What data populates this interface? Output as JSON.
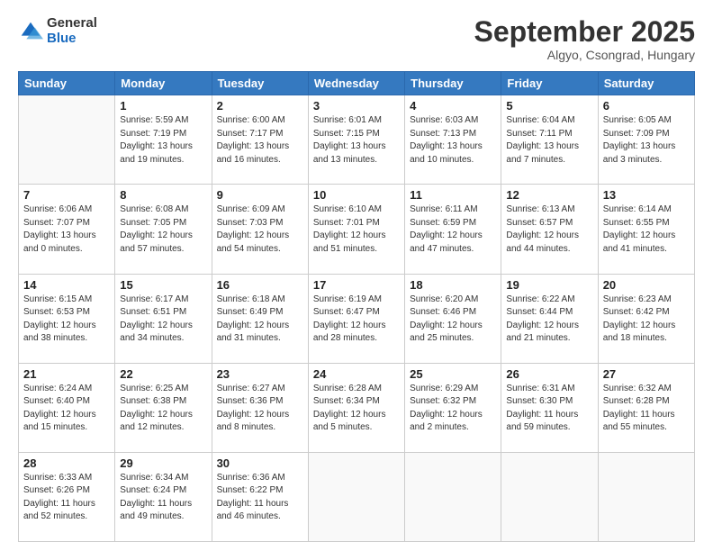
{
  "logo": {
    "general": "General",
    "blue": "Blue"
  },
  "header": {
    "month": "September 2025",
    "location": "Algyo, Csongrad, Hungary"
  },
  "days_of_week": [
    "Sunday",
    "Monday",
    "Tuesday",
    "Wednesday",
    "Thursday",
    "Friday",
    "Saturday"
  ],
  "weeks": [
    [
      {
        "day": "",
        "info": ""
      },
      {
        "day": "1",
        "info": "Sunrise: 5:59 AM\nSunset: 7:19 PM\nDaylight: 13 hours\nand 19 minutes."
      },
      {
        "day": "2",
        "info": "Sunrise: 6:00 AM\nSunset: 7:17 PM\nDaylight: 13 hours\nand 16 minutes."
      },
      {
        "day": "3",
        "info": "Sunrise: 6:01 AM\nSunset: 7:15 PM\nDaylight: 13 hours\nand 13 minutes."
      },
      {
        "day": "4",
        "info": "Sunrise: 6:03 AM\nSunset: 7:13 PM\nDaylight: 13 hours\nand 10 minutes."
      },
      {
        "day": "5",
        "info": "Sunrise: 6:04 AM\nSunset: 7:11 PM\nDaylight: 13 hours\nand 7 minutes."
      },
      {
        "day": "6",
        "info": "Sunrise: 6:05 AM\nSunset: 7:09 PM\nDaylight: 13 hours\nand 3 minutes."
      }
    ],
    [
      {
        "day": "7",
        "info": "Sunrise: 6:06 AM\nSunset: 7:07 PM\nDaylight: 13 hours\nand 0 minutes."
      },
      {
        "day": "8",
        "info": "Sunrise: 6:08 AM\nSunset: 7:05 PM\nDaylight: 12 hours\nand 57 minutes."
      },
      {
        "day": "9",
        "info": "Sunrise: 6:09 AM\nSunset: 7:03 PM\nDaylight: 12 hours\nand 54 minutes."
      },
      {
        "day": "10",
        "info": "Sunrise: 6:10 AM\nSunset: 7:01 PM\nDaylight: 12 hours\nand 51 minutes."
      },
      {
        "day": "11",
        "info": "Sunrise: 6:11 AM\nSunset: 6:59 PM\nDaylight: 12 hours\nand 47 minutes."
      },
      {
        "day": "12",
        "info": "Sunrise: 6:13 AM\nSunset: 6:57 PM\nDaylight: 12 hours\nand 44 minutes."
      },
      {
        "day": "13",
        "info": "Sunrise: 6:14 AM\nSunset: 6:55 PM\nDaylight: 12 hours\nand 41 minutes."
      }
    ],
    [
      {
        "day": "14",
        "info": "Sunrise: 6:15 AM\nSunset: 6:53 PM\nDaylight: 12 hours\nand 38 minutes."
      },
      {
        "day": "15",
        "info": "Sunrise: 6:17 AM\nSunset: 6:51 PM\nDaylight: 12 hours\nand 34 minutes."
      },
      {
        "day": "16",
        "info": "Sunrise: 6:18 AM\nSunset: 6:49 PM\nDaylight: 12 hours\nand 31 minutes."
      },
      {
        "day": "17",
        "info": "Sunrise: 6:19 AM\nSunset: 6:47 PM\nDaylight: 12 hours\nand 28 minutes."
      },
      {
        "day": "18",
        "info": "Sunrise: 6:20 AM\nSunset: 6:46 PM\nDaylight: 12 hours\nand 25 minutes."
      },
      {
        "day": "19",
        "info": "Sunrise: 6:22 AM\nSunset: 6:44 PM\nDaylight: 12 hours\nand 21 minutes."
      },
      {
        "day": "20",
        "info": "Sunrise: 6:23 AM\nSunset: 6:42 PM\nDaylight: 12 hours\nand 18 minutes."
      }
    ],
    [
      {
        "day": "21",
        "info": "Sunrise: 6:24 AM\nSunset: 6:40 PM\nDaylight: 12 hours\nand 15 minutes."
      },
      {
        "day": "22",
        "info": "Sunrise: 6:25 AM\nSunset: 6:38 PM\nDaylight: 12 hours\nand 12 minutes."
      },
      {
        "day": "23",
        "info": "Sunrise: 6:27 AM\nSunset: 6:36 PM\nDaylight: 12 hours\nand 8 minutes."
      },
      {
        "day": "24",
        "info": "Sunrise: 6:28 AM\nSunset: 6:34 PM\nDaylight: 12 hours\nand 5 minutes."
      },
      {
        "day": "25",
        "info": "Sunrise: 6:29 AM\nSunset: 6:32 PM\nDaylight: 12 hours\nand 2 minutes."
      },
      {
        "day": "26",
        "info": "Sunrise: 6:31 AM\nSunset: 6:30 PM\nDaylight: 11 hours\nand 59 minutes."
      },
      {
        "day": "27",
        "info": "Sunrise: 6:32 AM\nSunset: 6:28 PM\nDaylight: 11 hours\nand 55 minutes."
      }
    ],
    [
      {
        "day": "28",
        "info": "Sunrise: 6:33 AM\nSunset: 6:26 PM\nDaylight: 11 hours\nand 52 minutes."
      },
      {
        "day": "29",
        "info": "Sunrise: 6:34 AM\nSunset: 6:24 PM\nDaylight: 11 hours\nand 49 minutes."
      },
      {
        "day": "30",
        "info": "Sunrise: 6:36 AM\nSunset: 6:22 PM\nDaylight: 11 hours\nand 46 minutes."
      },
      {
        "day": "",
        "info": ""
      },
      {
        "day": "",
        "info": ""
      },
      {
        "day": "",
        "info": ""
      },
      {
        "day": "",
        "info": ""
      }
    ]
  ]
}
